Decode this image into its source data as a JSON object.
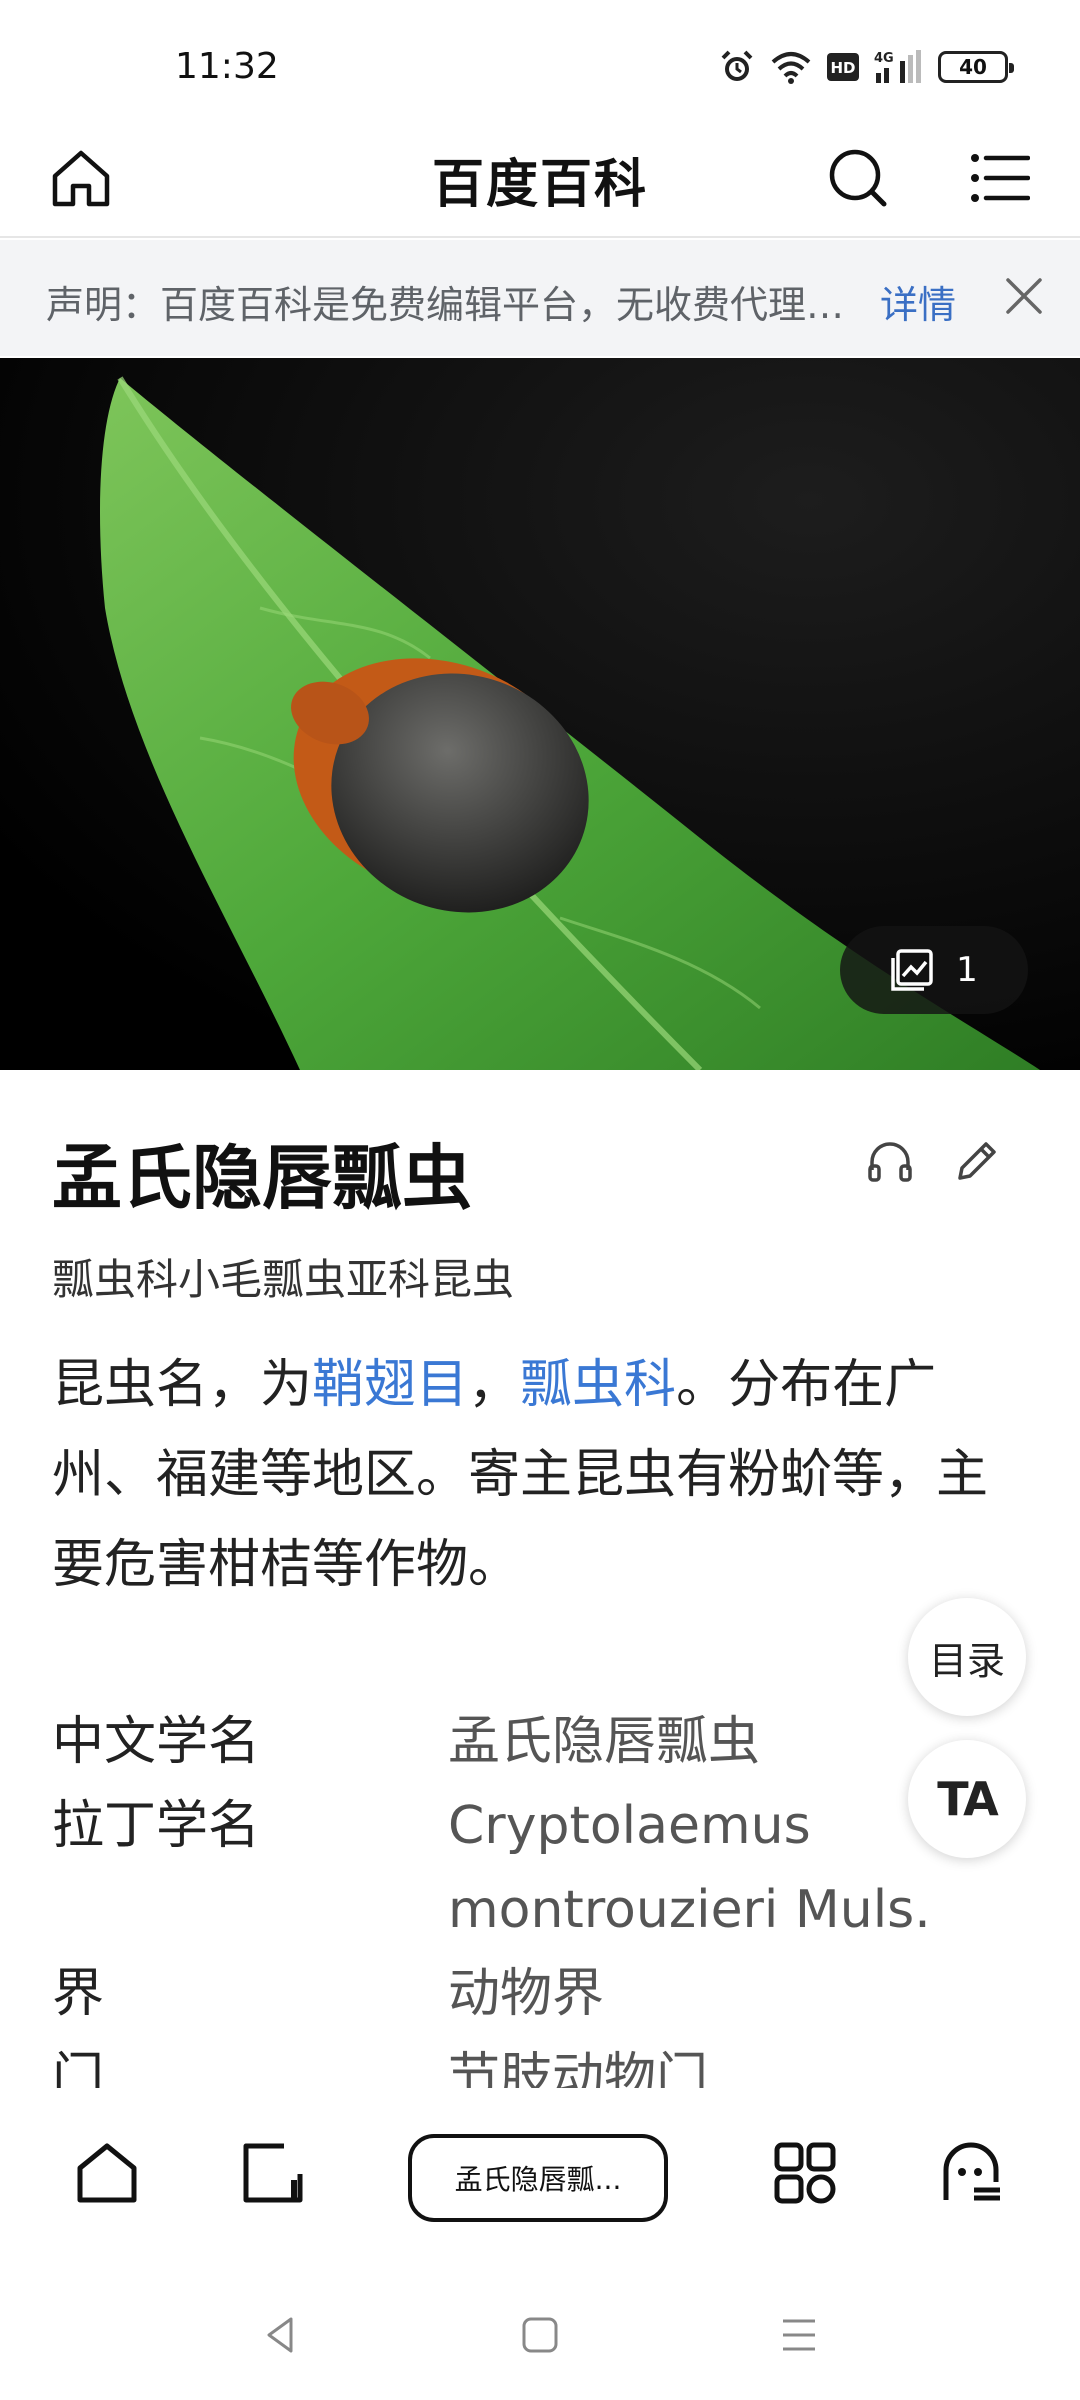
{
  "status_bar": {
    "time": "11:32",
    "battery": "40",
    "icons": [
      "alarm-icon",
      "wifi-icon",
      "hd-icon",
      "4g-signal-icon",
      "battery-icon"
    ]
  },
  "top_nav": {
    "title": "百度百科",
    "icons": [
      "home-icon",
      "search-icon",
      "menu-icon"
    ]
  },
  "notice": {
    "text": "声明：百度百科是免费编辑平台，无收费代理等商业服务",
    "link": "详情",
    "close_icon": "close-icon"
  },
  "hero": {
    "image_count": "1",
    "gallery_icon": "gallery-icon"
  },
  "article": {
    "title": "孟氏隐唇瓢虫",
    "subtitle": "瓢虫科小毛瓢虫亚科昆虫",
    "summary": {
      "part1": "昆虫名，为",
      "link1": "鞘翅目",
      "sep": "，",
      "link2": "瓢虫科",
      "part2": "。分布在广州、福建等地区。寄主昆虫有粉蚧等，主要危害柑桔等作物。"
    },
    "action_icons": [
      "headphones-icon",
      "edit-icon"
    ]
  },
  "info_table": [
    {
      "key": "中文学名",
      "value": "孟氏隐唇瓢虫"
    },
    {
      "key": "拉丁学名",
      "value": "Cryptolaemus montrouzieri Muls."
    },
    {
      "key": "界",
      "value": "动物界"
    },
    {
      "key": "门",
      "value": "节肢动物门 Arthropoda"
    }
  ],
  "floating": {
    "toc": "目录",
    "font_size": "TA"
  },
  "toolbar": {
    "current_page": "孟氏隐唇瓢...",
    "icons": [
      "home-icon",
      "tabs-icon",
      "apps-icon",
      "profile-icon"
    ]
  },
  "system_nav": {
    "icons": [
      "back-icon",
      "home-icon",
      "recent-apps-icon"
    ]
  }
}
